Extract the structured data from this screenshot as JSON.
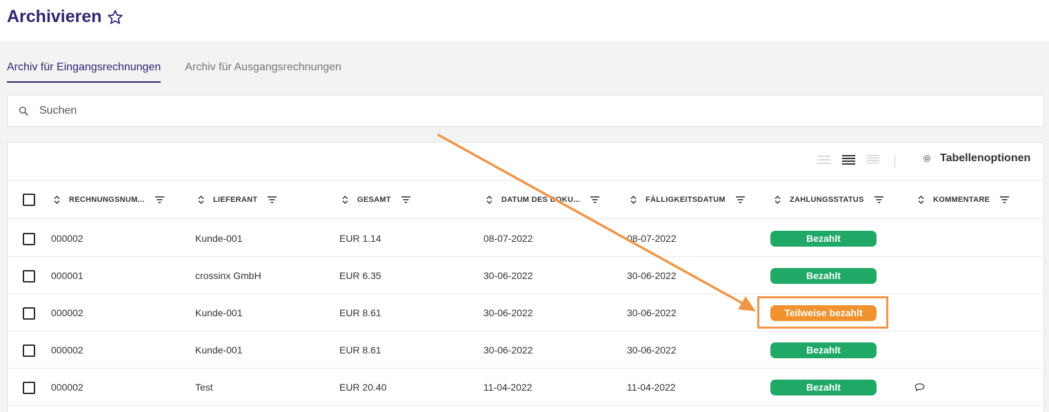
{
  "page": {
    "title": "Archivieren"
  },
  "tabs": [
    {
      "label": "Archiv für Eingangsrechnungen",
      "active": true
    },
    {
      "label": "Archiv für Ausgangsrechnungen",
      "active": false
    }
  ],
  "search": {
    "placeholder": "Suchen",
    "value": ""
  },
  "toolbar": {
    "table_options_label": "Tabellenoptionen"
  },
  "table": {
    "columns": [
      {
        "key": "rechnungsnummer",
        "label": "RECHNUNGSNUM..."
      },
      {
        "key": "lieferant",
        "label": "LIEFERANT"
      },
      {
        "key": "gesamt",
        "label": "GESAMT"
      },
      {
        "key": "datum",
        "label": "DATUM DES DOKU..."
      },
      {
        "key": "faelligkeit",
        "label": "FÄLLIGKEITSDATUM"
      },
      {
        "key": "status",
        "label": "ZAHLUNGSSTATUS"
      },
      {
        "key": "kommentare",
        "label": "KOMMENTARE"
      }
    ],
    "rows": [
      {
        "nummer": "000002",
        "lieferant": "Kunde-001",
        "gesamt": "EUR 1.14",
        "datum": "08-07-2022",
        "faellig": "08-07-2022",
        "status": "Bezahlt",
        "status_color": "#1fa866",
        "has_comment": false
      },
      {
        "nummer": "000001",
        "lieferant": "crossinx GmbH",
        "gesamt": "EUR 6.35",
        "datum": "30-06-2022",
        "faellig": "30-06-2022",
        "status": "Bezahlt",
        "status_color": "#1fa866",
        "has_comment": false
      },
      {
        "nummer": "000002",
        "lieferant": "Kunde-001",
        "gesamt": "EUR 8.61",
        "datum": "30-06-2022",
        "faellig": "30-06-2022",
        "status": "Teilweise bezahlt",
        "status_color": "#f0922e",
        "has_comment": false
      },
      {
        "nummer": "000002",
        "lieferant": "Kunde-001",
        "gesamt": "EUR 8.61",
        "datum": "30-06-2022",
        "faellig": "30-06-2022",
        "status": "Bezahlt",
        "status_color": "#1fa866",
        "has_comment": false
      },
      {
        "nummer": "000002",
        "lieferant": "Test",
        "gesamt": "EUR 20.40",
        "datum": "11-04-2022",
        "faellig": "11-04-2022",
        "status": "Bezahlt",
        "status_color": "#1fa866",
        "has_comment": true
      }
    ]
  },
  "colors": {
    "brand": "#2e2770",
    "paid": "#1fa866",
    "partial": "#f0922e",
    "annotation": "#ef9648"
  }
}
